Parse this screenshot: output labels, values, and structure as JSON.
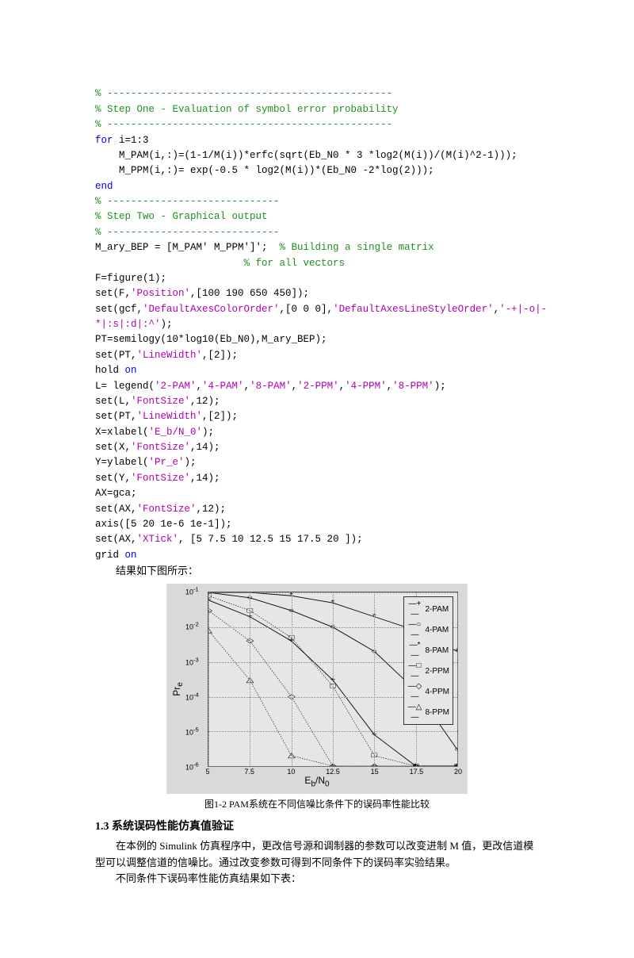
{
  "code": {
    "l1": "% ------------------------------------------------",
    "l2": "% Step One - Evaluation of symbol error probability",
    "l3": "% ------------------------------------------------",
    "l4a": "for",
    "l4b": " i=1:3",
    "l5": "    M_PAM(i,:)=(1-1/M(i))*erfc(sqrt(Eb_N0 * 3 *log2(M(i))/(M(i)^2-1)));",
    "l6": "    M_PPM(i,:)= exp(-0.5 * log2(M(i))*(Eb_N0 -2*log(2)));",
    "l7": "end",
    "l8": "% -----------------------------",
    "l9": "% Step Two - Graphical output",
    "l10": "% -----------------------------",
    "l11a": "M_ary_BEP = [M_PAM' M_PPM']';  ",
    "l11b": "% Building a single matrix",
    "l12": "                         % for all vectors",
    "l13": "F=figure(1);",
    "l14a": "set(F,",
    "l14b": "'Position'",
    "l14c": ",[100 190 650 450]);",
    "l15a": "set(gcf,",
    "l15b": "'DefaultAxesColorOrder'",
    "l15c": ",[0 0 0],",
    "l15d": "'DefaultAxesLineStyleOrder'",
    "l15e": ",",
    "l15f": "'-+|-o|-",
    "l15g": "*|:s|:d|:^'",
    "l15h": ");",
    "l16": "PT=semilogy(10*log10(Eb_N0),M_ary_BEP);",
    "l17a": "set(PT,",
    "l17b": "'LineWidth'",
    "l17c": ",[2]);",
    "l18a": "hold ",
    "l18b": "on",
    "l19a": "L= legend(",
    "l19s1": "'2-PAM'",
    "l19c1": ",",
    "l19s2": "'4-PAM'",
    "l19c2": ",",
    "l19s3": "'8-PAM'",
    "l19c3": ",",
    "l19s4": "'2-PPM'",
    "l19c4": ",",
    "l19s5": "'4-PPM'",
    "l19c5": ",",
    "l19s6": "'8-PPM'",
    "l19e": ");",
    "l20a": "set(L,",
    "l20b": "'FontSize'",
    "l20c": ",12);",
    "l21a": "set(PT,",
    "l21b": "'LineWidth'",
    "l21c": ",[2]);",
    "l22a": "X=xlabel(",
    "l22b": "'E_b/N_0'",
    "l22c": ");",
    "l23a": "set(X,",
    "l23b": "'FontSize'",
    "l23c": ",14);",
    "l24a": "Y=ylabel(",
    "l24b": "'Pr_e'",
    "l24c": ");",
    "l25a": "set(Y,",
    "l25b": "'FontSize'",
    "l25c": ",14);",
    "l26": "AX=gca;",
    "l27a": "set(AX,",
    "l27b": "'FontSize'",
    "l27c": ",12);",
    "l28": "axis([5 20 1e-6 1e-1]);",
    "l29a": "set(AX,",
    "l29b": "'XTick'",
    "l29c": ", [5 7.5 10 12.5 15 17.5 20 ]);",
    "l30a": "grid ",
    "l30b": "on"
  },
  "body": {
    "result_text": "结果如下图所示：",
    "caption": "图1-2 PAM系统在不同信噪比条件下的误码率性能比较",
    "section": "1.3 系统误码性能仿真值验证",
    "p1": "在本例的 Simulink 仿真程序中，更改信号源和调制器的参数可以改变进制 M 值，更改信道模型可以调整信道的信噪比。通过改变参数可得到不同条件下的误码率实验结果。",
    "p2": "不同条件下误码率性能仿真结果如下表："
  },
  "chart_data": {
    "type": "line",
    "xlabel": "E_b/N_0",
    "ylabel": "Pr_e",
    "xlim": [
      5,
      20
    ],
    "ylim": [
      1e-06,
      0.1
    ],
    "yscale": "log",
    "xticks": [
      5,
      7.5,
      10,
      12.5,
      15,
      17.5,
      20
    ],
    "yticks": [
      0.1,
      0.01,
      0.001,
      0.0001,
      1e-05,
      1e-06
    ],
    "legend_position": "top-right",
    "series": [
      {
        "name": "2-PAM",
        "marker": "+",
        "style": "solid",
        "x": [
          5,
          7.5,
          10,
          12.5,
          15,
          17.5,
          20
        ],
        "y": [
          0.06,
          0.02,
          0.004,
          0.0003,
          8e-06,
          1e-06,
          1e-06
        ]
      },
      {
        "name": "4-PAM",
        "marker": "o",
        "style": "solid",
        "x": [
          5,
          7.5,
          10,
          12.5,
          15,
          17.5,
          20
        ],
        "y": [
          0.1,
          0.07,
          0.03,
          0.01,
          0.002,
          0.00015,
          3e-06
        ]
      },
      {
        "name": "8-PAM",
        "marker": "*",
        "style": "solid",
        "x": [
          5,
          7.5,
          10,
          12.5,
          15,
          17.5,
          20
        ],
        "y": [
          0.1,
          0.1,
          0.08,
          0.05,
          0.02,
          0.008,
          0.002
        ]
      },
      {
        "name": "2-PPM",
        "marker": "s",
        "style": "dotted",
        "x": [
          5,
          7.5,
          10,
          12.5,
          15,
          17.5,
          20
        ],
        "y": [
          0.08,
          0.03,
          0.005,
          0.0002,
          2e-06,
          1e-06,
          1e-06
        ]
      },
      {
        "name": "4-PPM",
        "marker": "d",
        "style": "dotted",
        "x": [
          5,
          7.5,
          10,
          12.5,
          15,
          17.5,
          20
        ],
        "y": [
          0.03,
          0.004,
          0.0001,
          1e-06,
          1e-06,
          1e-06,
          1e-06
        ]
      },
      {
        "name": "8-PPM",
        "marker": "^",
        "style": "dotted",
        "x": [
          5,
          7.5,
          10,
          12.5,
          15,
          17.5,
          20
        ],
        "y": [
          0.008,
          0.0003,
          2e-06,
          1e-06,
          1e-06,
          1e-06,
          1e-06
        ]
      }
    ]
  }
}
